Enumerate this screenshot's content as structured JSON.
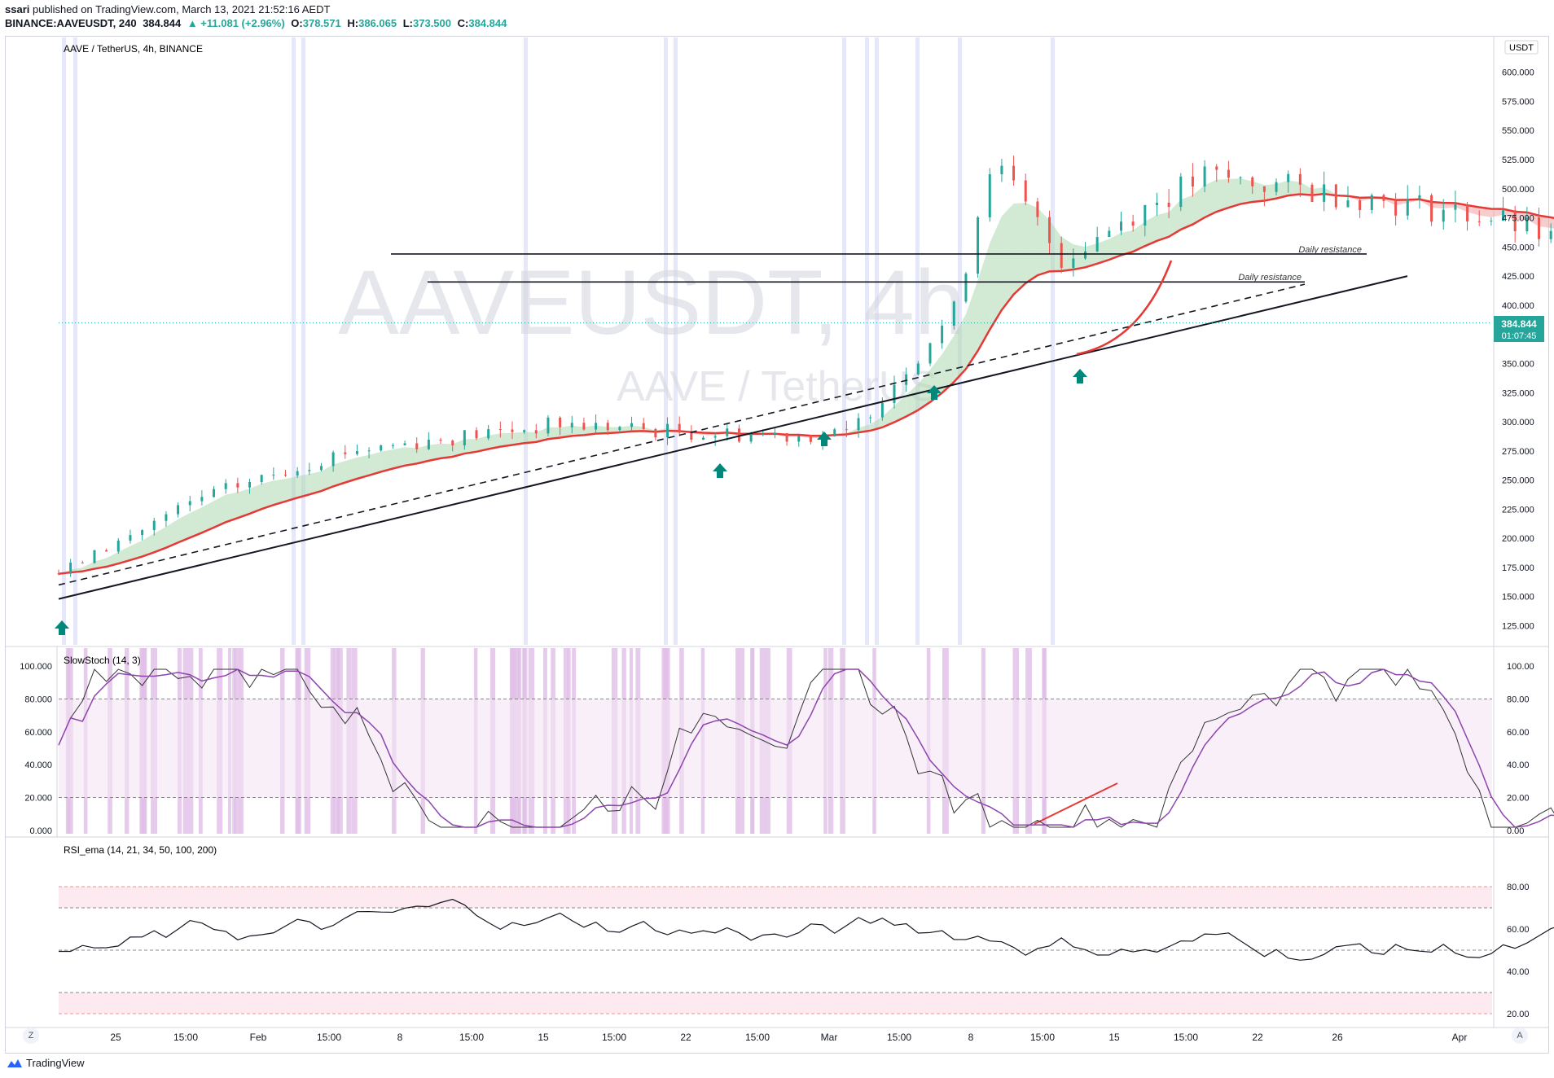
{
  "header": {
    "publish_line_user": "ssari",
    "publish_line_rest": "published on TradingView.com, March 13, 2021 21:52:16 AEDT",
    "symbol": "BINANCE:AAVEUSDT, 240",
    "last": "384.844",
    "change": "▲ +11.081 (+2.96%)",
    "o_label": "O:",
    "o": "378.571",
    "h_label": "H:",
    "h": "386.065",
    "l_label": "L:",
    "l": "373.500",
    "c_label": "C:",
    "c": "384.844"
  },
  "main_pane": {
    "legend": "AAVE / TetherUS, 4h, BINANCE",
    "watermark_symbol": "AAVEUSDT, 4h",
    "watermark_name": "AAVE / TetherUS",
    "currency": "USDT",
    "price_badge": "384.844",
    "countdown": "01:07:45",
    "annotations": [
      "Daily resistance",
      "Daily resistance"
    ]
  },
  "stoch_pane": {
    "legend": "SlowStoch (14, 3)"
  },
  "rsi_pane": {
    "legend": "RSI_ema (14, 21, 34, 50, 100, 200)"
  },
  "x_axis": [
    "25",
    "15:00",
    "Feb",
    "15:00",
    "8",
    "15:00",
    "15",
    "15:00",
    "22",
    "15:00",
    "Mar",
    "15:00",
    "8",
    "15:00",
    "15",
    "15:00",
    "22",
    "26",
    "Apr"
  ],
  "footer": {
    "brand": "TradingView",
    "left_btn": "Z",
    "right_btn": "A"
  },
  "colors": {
    "up": "#26a69a",
    "down": "#ef5350",
    "ema": "#e53935",
    "stoch": "#8e44ad",
    "band": "#e1bee7",
    "arrow": "#00897b"
  },
  "chart_data": [
    {
      "type": "candlestick",
      "title": "AAVE / TetherUS, 4h, BINANCE",
      "ylabel": "USDT",
      "ylim": [
        110,
        620
      ],
      "y_ticks": [
        125,
        150,
        175,
        200,
        225,
        250,
        275,
        300,
        325,
        350,
        375,
        400,
        425,
        450,
        475,
        500,
        525,
        550,
        575,
        600
      ],
      "x_range_days": [
        "Jan 20",
        "Apr 2"
      ],
      "last_close": 384.844,
      "close_path": [
        [
          0,
          170
        ],
        [
          2,
          235
        ],
        [
          4,
          275
        ],
        [
          7,
          298
        ],
        [
          9,
          290
        ],
        [
          11,
          288
        ],
        [
          12.5,
          395
        ],
        [
          13,
          525
        ],
        [
          14,
          440
        ],
        [
          15,
          480
        ],
        [
          16,
          510
        ],
        [
          18,
          495
        ],
        [
          20,
          475
        ],
        [
          22,
          430
        ],
        [
          23,
          410
        ],
        [
          25,
          455
        ],
        [
          27,
          420
        ],
        [
          28,
          330
        ],
        [
          30,
          300
        ],
        [
          32,
          330
        ],
        [
          34,
          395
        ],
        [
          36,
          385
        ],
        [
          38,
          370
        ],
        [
          40,
          375
        ],
        [
          42,
          405
        ],
        [
          44,
          445
        ],
        [
          46,
          430
        ],
        [
          48,
          410
        ],
        [
          50,
          395
        ],
        [
          51.6,
          373
        ],
        [
          51.8,
          384.8
        ]
      ],
      "support_line_solid": [
        [
          0,
          148
        ],
        [
          70,
          425
        ]
      ],
      "support_line_dashed": [
        [
          0,
          160
        ],
        [
          63,
          418
        ]
      ],
      "resistance_lines": [
        {
          "label": "Daily resistance",
          "value": 444
        },
        {
          "label": "Daily resistance",
          "value": 420
        }
      ]
    },
    {
      "type": "line",
      "title": "SlowStoch (14, 3)",
      "ylim": [
        0,
        100
      ],
      "y_ticks": [
        "0.00",
        "20.00",
        "40.00",
        "60.00",
        "80.00",
        "100.00"
      ],
      "left_ticks": [
        "0.000",
        "20.000",
        "40.000",
        "60.000",
        "80.000",
        "100.000"
      ],
      "levels": [
        20,
        80
      ]
    },
    {
      "type": "line",
      "title": "RSI_ema (14, 21, 34, 50, 100, 200)",
      "ylim": [
        15,
        95
      ],
      "y_ticks": [
        "20.00",
        "40.00",
        "60.00",
        "80.00"
      ],
      "levels": [
        20,
        30,
        50,
        70,
        80
      ]
    }
  ]
}
